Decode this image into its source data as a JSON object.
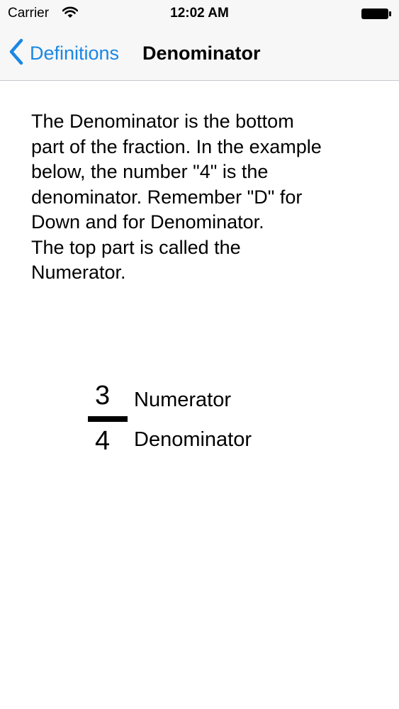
{
  "status_bar": {
    "carrier": "Carrier",
    "time": "12:02 AM"
  },
  "nav_bar": {
    "back_label": "Definitions",
    "title": "Denominator"
  },
  "content": {
    "lines": [
      "The Denominator is the bottom",
      "part of the fraction.  In the example",
      "below, the number \"4\" is the",
      "denominator.  Remember \"D\" for",
      "Down and for Denominator.",
      "The top part is called the",
      "Numerator."
    ]
  },
  "fraction": {
    "numerator": "3",
    "denominator": "4",
    "numerator_label": "Numerator",
    "denominator_label": "Denominator"
  },
  "colors": {
    "accent": "#1a87e5",
    "bar_background": "#f7f7f7"
  },
  "icons": {
    "wifi": "wifi-icon",
    "battery": "battery-icon",
    "back": "chevron-left-icon"
  }
}
